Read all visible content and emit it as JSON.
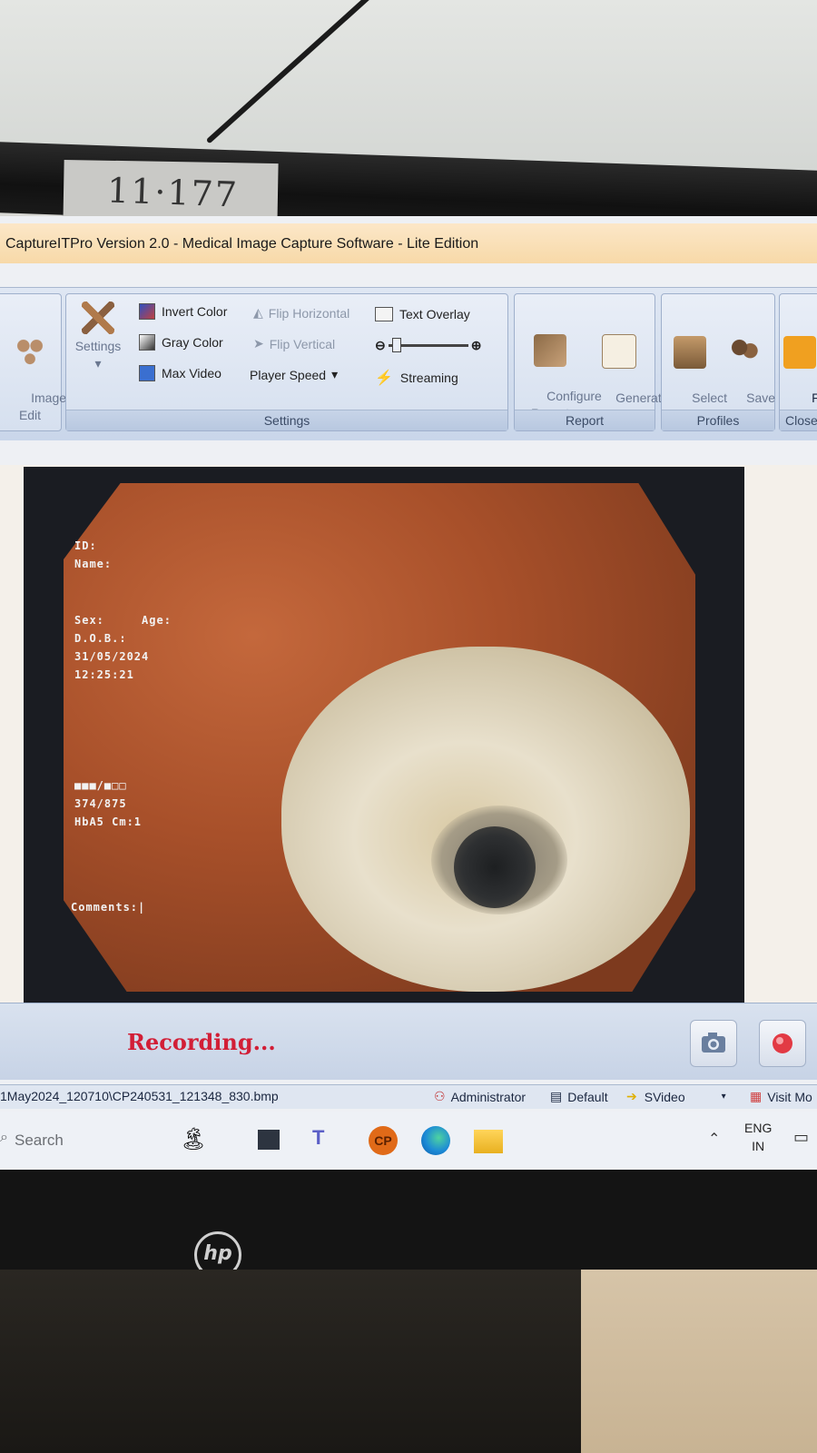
{
  "label_tape": "11·177",
  "window": {
    "title": "CaptureITPro Version 2.0 - Medical Image Capture Software - Lite Edition"
  },
  "ribbon": {
    "image_edit": "Image\nEdit",
    "settings_btn": "Settings",
    "invert_color": "Invert Color",
    "gray_color": "Gray Color",
    "max_video": "Max Video",
    "flip_horizontal": "Flip Horizontal",
    "flip_vertical": "Flip Vertical",
    "player_speed": "Player Speed",
    "text_overlay": "Text Overlay",
    "streaming": "Streaming",
    "settings_group": "Settings",
    "configure_report": "Configure\nReport",
    "generate_report": "Generate\nReport",
    "report_group": "Report",
    "select_profile": "Select\nProfile",
    "save_profile": "Save\nProfile",
    "profiles_group": "Profiles",
    "finish": "Finish\nGoBac",
    "close_group": "Close"
  },
  "overlay": {
    "id": "ID:",
    "name": "Name:",
    "sex_age": "Sex:     Age:",
    "dob": "D.O.B.:",
    "date": "31/05/2024",
    "time": "12:25:21",
    "blocks": "■■■/■□□",
    "code": "374/875",
    "misc": "HbA5 Cm:1",
    "comments": "Comments:|"
  },
  "recording": "Recording...",
  "status": {
    "path": "1May2024_120710\\CP240531_121348_830.bmp",
    "user": "Administrator",
    "profile": "Default",
    "source": "SVideo",
    "visit": "Visit Mo"
  },
  "taskbar": {
    "search": "Search",
    "lang": "ENG",
    "region": "IN",
    "cp": "CP"
  },
  "brand": "hp"
}
